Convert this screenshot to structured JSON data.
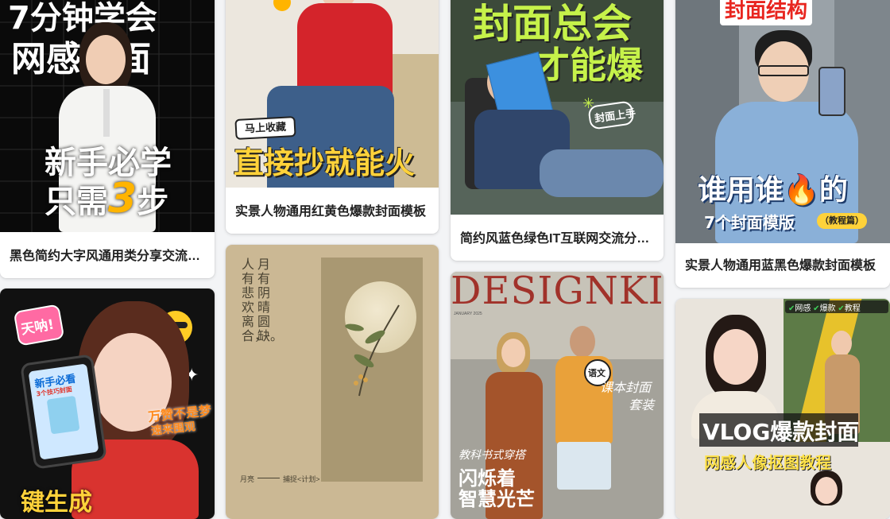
{
  "cards": [
    {
      "title": "黑色简约大字风通用类分享交流封面",
      "poster": {
        "line1": "7分钟学会",
        "line2": "网感封面",
        "line3": "新手必学",
        "line4a": "只需",
        "num": "3",
        "line4b": "步"
      }
    },
    {
      "title": "实景人物通用红黄色爆款封面模板",
      "poster": {
        "tag": "马上收藏",
        "headline": "直接抄就能火"
      }
    },
    {
      "title": "简约风蓝色绿色IT互联网交流分享封面",
      "poster": {
        "line1": "封面总会",
        "line2": "才能爆",
        "note": "封面上手"
      }
    },
    {
      "title": "实景人物通用蓝黑色爆款封面模板",
      "poster": {
        "top": "封面结构",
        "line1a": "谁用谁",
        "line1b": "的",
        "line2": "7个封面模版",
        "tag": "（教程篇）"
      }
    },
    {
      "poster": {
        "shout": "天呐!",
        "phone_line1": "新手必看",
        "phone_line2": "3个技巧封面",
        "side1": "万赞不是梦",
        "side2": "速来围观",
        "bottom": "键生成"
      }
    },
    {
      "poster": {
        "col1": "人有悲欢离合，",
        "col2": "月有阴晴圆缺。",
        "foot1": "月亮",
        "foot2": "捕捉<计划>"
      }
    },
    {
      "poster": {
        "masthead": "DESIGNKIT",
        "date": "JANUARY 2025",
        "badge": "语文",
        "right1": "课本封面",
        "right2": "套装",
        "sub": "教科书式穿搭",
        "big1": "闪烁着",
        "big2": "智慧光芒"
      }
    },
    {
      "poster": {
        "tags": [
          "网感",
          "爆款",
          "教程"
        ],
        "line1": "VLOG爆款封面",
        "line2": "网感人像抠图教程"
      }
    }
  ],
  "colors": {
    "page_bg": "#f3f4f6",
    "card_bg": "#ffffff",
    "title_text": "#222222",
    "accent_yellow": "#ffd23a",
    "accent_green": "#c6f24a",
    "accent_red": "#e8251f"
  }
}
